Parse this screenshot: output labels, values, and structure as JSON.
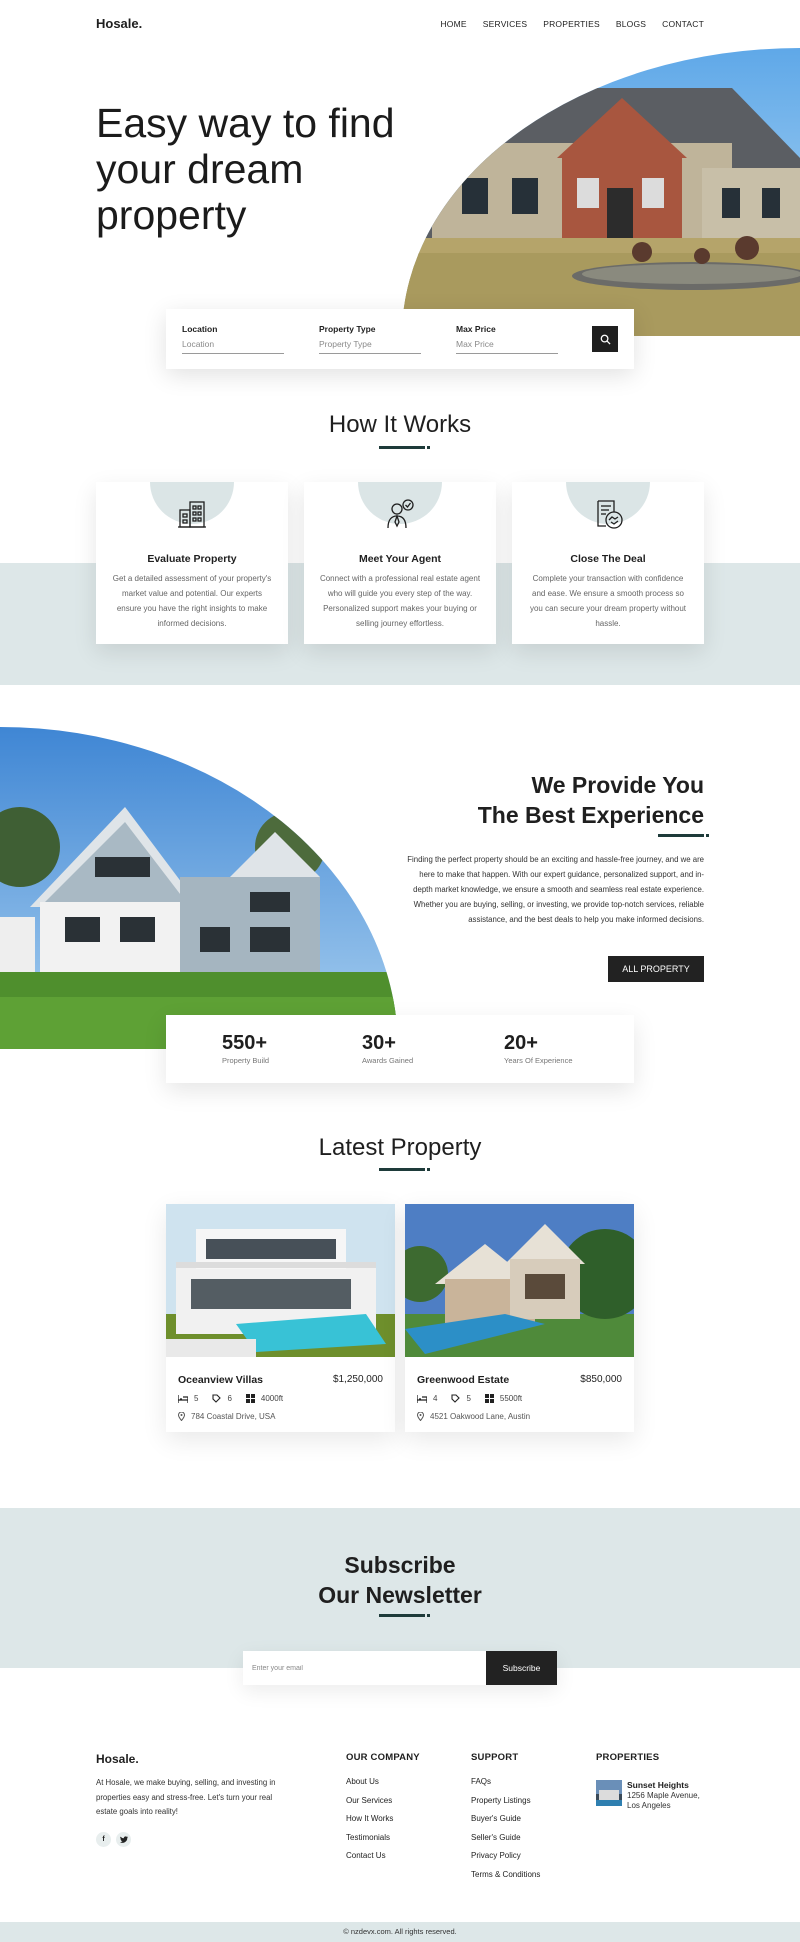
{
  "header": {
    "logo": "Hosale.",
    "nav": [
      "HOME",
      "SERVICES",
      "PROPERTIES",
      "BLOGS",
      "CONTACT"
    ]
  },
  "hero": {
    "title": "Easy way to find your dream property",
    "search": {
      "location_label": "Location",
      "location_placeholder": "Location",
      "type_label": "Property Type",
      "type_placeholder": "Property Type",
      "price_label": "Max Price",
      "price_placeholder": "Max Price",
      "button_icon": "search-icon"
    }
  },
  "how_it_works": {
    "title": "How It Works",
    "steps": [
      {
        "icon": "building-icon",
        "title": "Evaluate Property",
        "text": "Get a detailed assessment of your property's market value and potential. Our experts ensure you have the right insights to make informed decisions."
      },
      {
        "icon": "agent-icon",
        "title": "Meet Your Agent",
        "text": "Connect with a professional real estate agent who will guide you every step of the way. Personalized support makes your buying or selling journey effortless."
      },
      {
        "icon": "contract-handshake-icon",
        "title": "Close The Deal",
        "text": "Complete your transaction with confidence and ease. We ensure a smooth process so you can secure your dream property without hassle."
      }
    ]
  },
  "provide": {
    "title_line1": "We Provide You",
    "title_line2": "The Best Experience",
    "text": "Finding the perfect property should be an exciting and hassle-free journey, and we are here to make that happen. With our expert guidance, personalized support, and in-depth market knowledge, we ensure a smooth and seamless real estate experience. Whether you are buying, selling, or investing, we provide top-notch services, reliable assistance, and the best deals to help you make informed decisions.",
    "button": "ALL PROPERTY",
    "stats": [
      {
        "value": "550+",
        "label": "Property Build"
      },
      {
        "value": "30+",
        "label": "Awards Gained"
      },
      {
        "value": "20+",
        "label": "Years Of Experience"
      }
    ]
  },
  "latest": {
    "title": "Latest Property",
    "properties": [
      {
        "name": "Oceanview Villas",
        "price": "$1,250,000",
        "beds": "5",
        "tags": "6",
        "area": "4000ft",
        "address": "784 Coastal Drive, USA"
      },
      {
        "name": "Greenwood Estate",
        "price": "$850,000",
        "beds": "4",
        "tags": "5",
        "area": "5500ft",
        "address": "4521 Oakwood Lane, Austin"
      }
    ]
  },
  "newsletter": {
    "title_line1": "Subscribe",
    "title_line2": "Our Newsletter",
    "placeholder": "Enter your email",
    "button": "Subscribe"
  },
  "footer": {
    "logo": "Hosale.",
    "about": "At Hosale, we make buying, selling, and investing in properties easy and stress-free. Let's turn your real estate goals into reality!",
    "social": [
      "f",
      "t"
    ],
    "company_title": "OUR COMPANY",
    "company_links": [
      "About Us",
      "Our Services",
      "How It Works",
      "Testimonials",
      "Contact Us"
    ],
    "support_title": "SUPPORT",
    "support_links": [
      "FAQs",
      "Property Listings",
      "Buyer's Guide",
      "Seller's Guide",
      "Privacy Policy",
      "Terms & Conditions"
    ],
    "properties_title": "PROPERTIES",
    "featured": {
      "name": "Sunset Heights",
      "address": "1256 Maple Avenue, Los Angeles"
    },
    "copyright": "© nzdevx.com. All rights reserved."
  },
  "colors": {
    "accent": "#1e3b3a",
    "band": "#dde7e8",
    "dark": "#222222"
  }
}
